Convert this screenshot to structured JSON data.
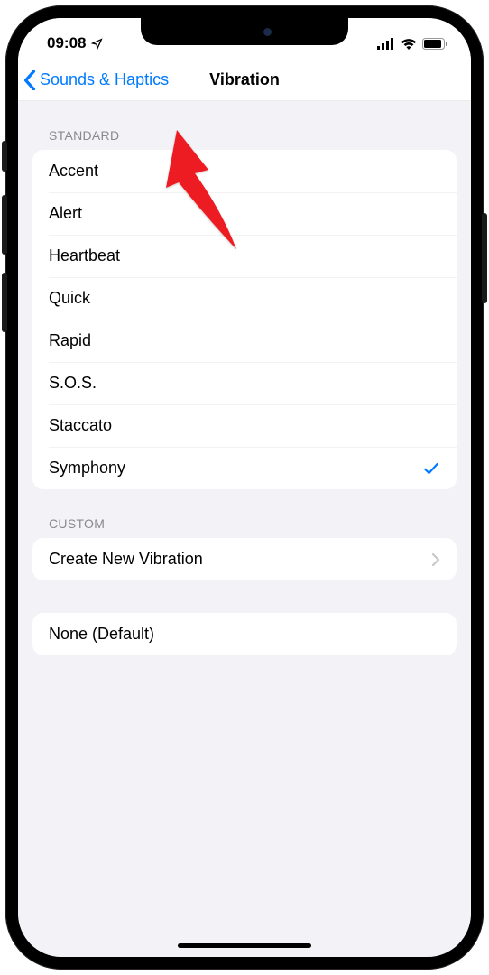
{
  "status": {
    "time": "09:08"
  },
  "nav": {
    "back_label": "Sounds & Haptics",
    "title": "Vibration"
  },
  "sections": {
    "standard": {
      "header": "STANDARD",
      "rows": [
        {
          "label": "Accent",
          "selected": false
        },
        {
          "label": "Alert",
          "selected": false
        },
        {
          "label": "Heartbeat",
          "selected": false
        },
        {
          "label": "Quick",
          "selected": false
        },
        {
          "label": "Rapid",
          "selected": false
        },
        {
          "label": "S.O.S.",
          "selected": false
        },
        {
          "label": "Staccato",
          "selected": false
        },
        {
          "label": "Symphony",
          "selected": true
        }
      ]
    },
    "custom": {
      "header": "CUSTOM",
      "create_label": "Create New Vibration"
    },
    "none": {
      "none_label": "None (Default)"
    }
  }
}
